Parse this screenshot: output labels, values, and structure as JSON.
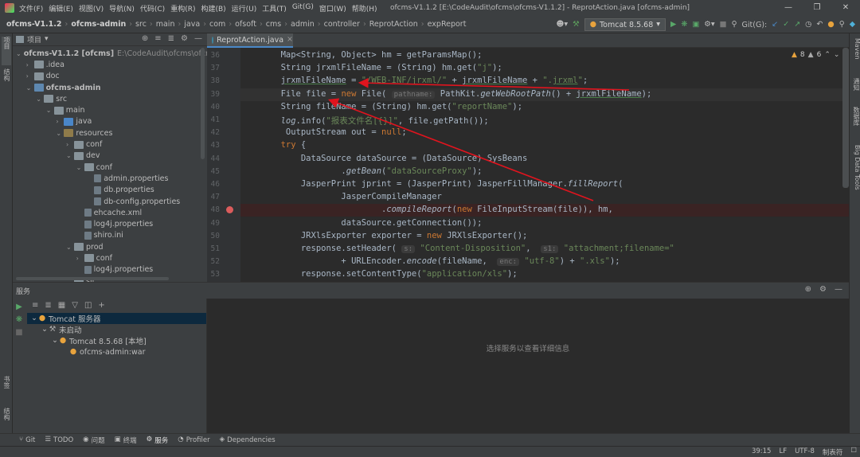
{
  "titlebar": {
    "menu": [
      "文件(F)",
      "编辑(E)",
      "视图(V)",
      "导航(N)",
      "代码(C)",
      "重构(R)",
      "构建(B)",
      "运行(U)",
      "工具(T)",
      "Git(G)",
      "窗口(W)",
      "帮助(H)"
    ],
    "window_title": "ofcms-V1.1.2 [E:\\CodeAudit\\ofcms\\ofcms-V1.1.2] - ReprotAction.java [ofcms-admin]"
  },
  "navbar": {
    "breadcrumbs": [
      "ofcms-V1.1.2",
      "ofcms-admin",
      "src",
      "main",
      "java",
      "com",
      "ofsoft",
      "cms",
      "admin",
      "controller",
      "ReprotAction",
      "expReport"
    ],
    "run_config": "Tomcat 8.5.68",
    "git_label": "Git(G):"
  },
  "left_strip": {
    "project_tab": "项目",
    "structure_tab": "结构",
    "bookmarks_tab": "书签",
    "web_tab": "结构"
  },
  "right_strip": {
    "maven": "Maven",
    "notifications": "通知",
    "database": "数据库",
    "big_data": "Big Data Tools"
  },
  "project": {
    "title": "项目",
    "tree": [
      {
        "label": "ofcms-V1.1.2 [ofcms]",
        "sub": "E:\\CodeAudit\\ofcms\\ofcms-V",
        "depth": 0,
        "open": true,
        "kind": "module",
        "bold": true
      },
      {
        "label": ".idea",
        "depth": 1,
        "open": false,
        "kind": "folder"
      },
      {
        "label": "doc",
        "depth": 1,
        "open": false,
        "kind": "folder"
      },
      {
        "label": "ofcms-admin",
        "depth": 1,
        "open": true,
        "kind": "module",
        "bold": true
      },
      {
        "label": "src",
        "depth": 2,
        "open": true,
        "kind": "folder"
      },
      {
        "label": "main",
        "depth": 3,
        "open": true,
        "kind": "folder"
      },
      {
        "label": "java",
        "depth": 4,
        "open": false,
        "kind": "folder-src"
      },
      {
        "label": "resources",
        "depth": 4,
        "open": true,
        "kind": "folder-res"
      },
      {
        "label": "conf",
        "depth": 5,
        "open": false,
        "kind": "folder"
      },
      {
        "label": "dev",
        "depth": 5,
        "open": true,
        "kind": "folder"
      },
      {
        "label": "conf",
        "depth": 6,
        "open": true,
        "kind": "folder"
      },
      {
        "label": "admin.properties",
        "depth": 7,
        "kind": "file"
      },
      {
        "label": "db.properties",
        "depth": 7,
        "kind": "file"
      },
      {
        "label": "db-config.properties",
        "depth": 7,
        "kind": "file"
      },
      {
        "label": "ehcache.xml",
        "depth": 6,
        "kind": "file"
      },
      {
        "label": "log4j.properties",
        "depth": 6,
        "kind": "file"
      },
      {
        "label": "shiro.ini",
        "depth": 6,
        "kind": "file"
      },
      {
        "label": "prod",
        "depth": 5,
        "open": true,
        "kind": "folder"
      },
      {
        "label": "conf",
        "depth": 6,
        "open": false,
        "kind": "folder"
      },
      {
        "label": "log4j.properties",
        "depth": 6,
        "kind": "file"
      },
      {
        "label": "sit",
        "depth": 5,
        "open": true,
        "kind": "folder"
      }
    ]
  },
  "editor": {
    "tab_label": "ReprotAction.java",
    "warnings": "8",
    "weak_warnings": "6",
    "current_line": 39,
    "breakpoint_line": 48,
    "lines": [
      {
        "n": "36",
        "html": "        Map&lt;String, Object&gt; hm = getParamsMap();"
      },
      {
        "n": "37",
        "html": "        String jrxmlFileName = (String) hm.get(<span class=\"str\">\"j\"</span>);"
      },
      {
        "n": "38",
        "html": "        <span class=\"ul\">jrxmlFileName</span> = <span class=\"str\">\"/WEB-INF/jrxml/\"</span> + <span class=\"ul\">jrxmlFileName</span> + <span class=\"str\">\".<span class=\"ul\">jrxml</span>\"</span>;"
      },
      {
        "n": "39",
        "html": "        File file = <span class=\"kw\">new</span> File( <span class=\"hint\">pathname:</span> PathKit.<span class=\"it\">getWebRootPath</span>() + <span class=\"ul\">jrxmlFileName</span>);"
      },
      {
        "n": "40",
        "html": "        String fileName = (String) hm.get(<span class=\"str\">\"reportName\"</span>);"
      },
      {
        "n": "41",
        "html": "        <span class=\"it\">log</span>.info(<span class=\"str\">\"报表文件名[{}]\"</span>, file.getPath());"
      },
      {
        "n": "42",
        "html": "         OutputStream out = <span class=\"kw\">null</span>;"
      },
      {
        "n": "43",
        "html": "        <span class=\"kw\">try</span> {"
      },
      {
        "n": "44",
        "html": "            DataSource dataSource = (DataSource) SysBeans"
      },
      {
        "n": "45",
        "html": "                    .<span class=\"it\">getBean</span>(<span class=\"str\">\"dataSourceProxy\"</span>);"
      },
      {
        "n": "46",
        "html": "            JasperPrint jprint = (JasperPrint) JasperFillManager.<span class=\"it\">fillReport</span>("
      },
      {
        "n": "47",
        "html": "                    JasperCompileManager"
      },
      {
        "n": "48",
        "html": "                            .<span class=\"it\">compileReport</span>(<span class=\"kw\">new</span> FileInputStream(file)), hm,"
      },
      {
        "n": "49",
        "html": "                    dataSource.getConnection());"
      },
      {
        "n": "50",
        "html": "            JRXlsExporter exporter = <span class=\"kw\">new</span> JRXlsExporter();"
      },
      {
        "n": "51",
        "html": "            response.setHeader( <span class=\"hint\">s:</span> <span class=\"str\">\"Content-Disposition\"</span>,  <span class=\"hint\">s1:</span> <span class=\"str\">\"attachment;filename=\"</span>"
      },
      {
        "n": "52",
        "html": "                    + URLEncoder.<span class=\"it\">encode</span>(fileName,  <span class=\"hint\">enc:</span> <span class=\"str\">\"utf-8\"</span>) + <span class=\"str\">\".xls\"</span>);"
      },
      {
        "n": "53",
        "html": "            response.setContentType(<span class=\"str\">\"application/xls\"</span>);"
      }
    ]
  },
  "services": {
    "title": "服务",
    "tree": [
      {
        "label": "Tomcat 服务器",
        "depth": 0,
        "selected": true
      },
      {
        "label": "未启动",
        "depth": 1
      },
      {
        "label": "Tomcat 8.5.68 [本地]",
        "depth": 2
      },
      {
        "label": "ofcms-admin:war",
        "depth": 3
      }
    ],
    "empty_message": "选择服务以查看详细信息"
  },
  "tooltabs": [
    "Git",
    "TODO",
    "问题",
    "终端",
    "服务",
    "Profiler",
    "Dependencies"
  ],
  "statusbar": {
    "position": "39:15",
    "line_sep": "LF",
    "encoding": "UTF-8",
    "indent": "制表符"
  },
  "colors": {
    "accent": "#4a88c7",
    "arrow": "#e0141e",
    "breakpoint": "#db5c5c"
  }
}
